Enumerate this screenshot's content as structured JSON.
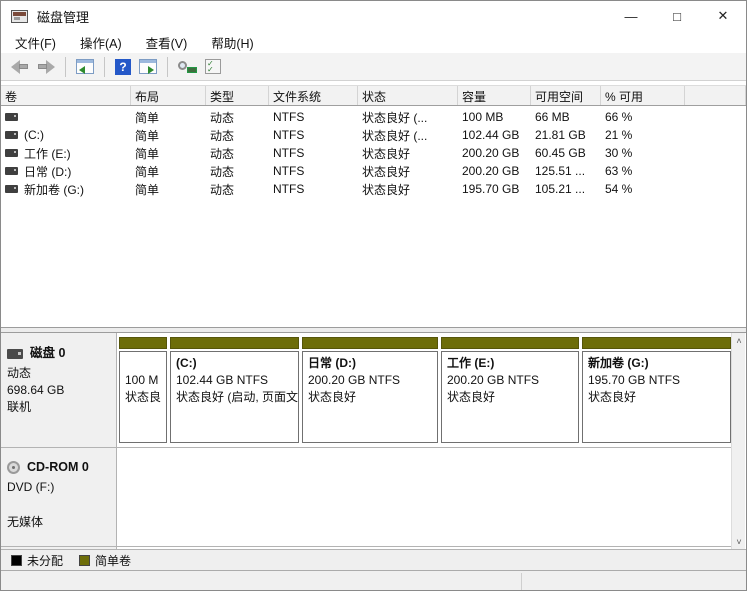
{
  "window": {
    "title": "磁盘管理",
    "controls": {
      "minimize": "—",
      "maximize": "□",
      "close": "✕"
    }
  },
  "menu": {
    "items": [
      {
        "label": "文件(F)"
      },
      {
        "label": "操作(A)"
      },
      {
        "label": "查看(V)"
      },
      {
        "label": "帮助(H)"
      }
    ]
  },
  "toolbar": {
    "icons": [
      "back-icon",
      "forward-icon",
      "console-tree-icon",
      "help-icon",
      "action-pane-icon",
      "disk-view-icon",
      "task-list-icon"
    ]
  },
  "volume_list": {
    "columns": [
      "卷",
      "布局",
      "类型",
      "文件系统",
      "状态",
      "容量",
      "可用空间",
      "% 可用"
    ],
    "rows": [
      {
        "volume": "",
        "layout": "简单",
        "type": "动态",
        "fs": "NTFS",
        "status": "状态良好 (...",
        "capacity": "100 MB",
        "free": "66 MB",
        "pct": "66 %"
      },
      {
        "volume": "(C:)",
        "layout": "简单",
        "type": "动态",
        "fs": "NTFS",
        "status": "状态良好 (...",
        "capacity": "102.44 GB",
        "free": "21.81 GB",
        "pct": "21 %"
      },
      {
        "volume": "工作 (E:)",
        "layout": "简单",
        "type": "动态",
        "fs": "NTFS",
        "status": "状态良好",
        "capacity": "200.20 GB",
        "free": "60.45 GB",
        "pct": "30 %"
      },
      {
        "volume": "日常 (D:)",
        "layout": "简单",
        "type": "动态",
        "fs": "NTFS",
        "status": "状态良好",
        "capacity": "200.20 GB",
        "free": "125.51 ...",
        "pct": "63 %"
      },
      {
        "volume": "新加卷 (G:)",
        "layout": "简单",
        "type": "动态",
        "fs": "NTFS",
        "status": "状态良好",
        "capacity": "195.70 GB",
        "free": "105.21 ...",
        "pct": "54 %"
      }
    ]
  },
  "disk0": {
    "name": "磁盘 0",
    "type": "动态",
    "size": "698.64 GB",
    "status": "联机",
    "partitions": [
      {
        "name": "",
        "size": "100 M",
        "status": "状态良"
      },
      {
        "name": "(C:)",
        "size": "102.44 GB NTFS",
        "status": "状态良好 (启动, 页面文"
      },
      {
        "name": "日常  (D:)",
        "size": "200.20 GB NTFS",
        "status": "状态良好"
      },
      {
        "name": "工作  (E:)",
        "size": "200.20 GB NTFS",
        "status": "状态良好"
      },
      {
        "name": "新加卷  (G:)",
        "size": "195.70 GB NTFS",
        "status": "状态良好"
      }
    ]
  },
  "cdrom": {
    "name": "CD-ROM 0",
    "drive": "DVD (F:)",
    "media": "无媒体"
  },
  "legend": {
    "items": [
      {
        "label": "未分配",
        "color": "#000000"
      },
      {
        "label": "简单卷",
        "color": "#6d6d09"
      }
    ]
  },
  "colors": {
    "simple_volume": "#6d6d09",
    "unallocated": "#000000"
  },
  "scrollbar": {
    "up": "˄",
    "down": "˅"
  }
}
